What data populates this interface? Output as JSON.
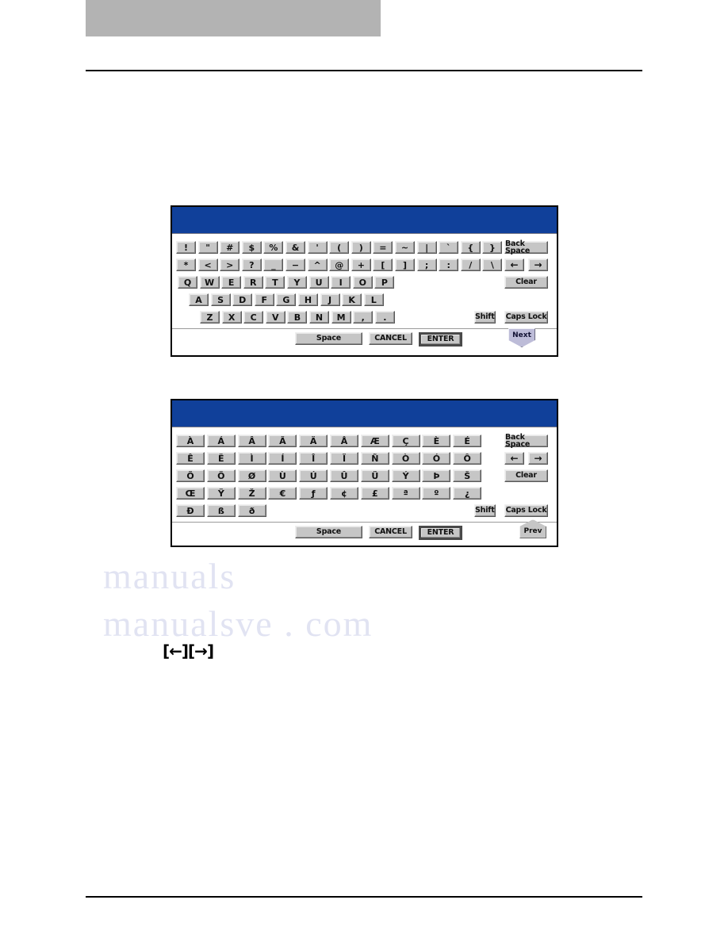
{
  "page": {
    "header_block_label": "",
    "arrow_legend": "[←][→]"
  },
  "keyboard_standard": {
    "title": "",
    "rows": [
      [
        "!",
        "\"",
        "#",
        "$",
        "%",
        "&",
        "'",
        "(",
        ")",
        "=",
        "~",
        "|",
        "`",
        "{",
        "}"
      ],
      [
        "*",
        "<",
        ">",
        "?",
        "_",
        "−",
        "^",
        "@",
        "+",
        "[",
        "]",
        ";",
        ":",
        "/",
        "\\"
      ],
      [
        "Q",
        "W",
        "E",
        "R",
        "T",
        "Y",
        "U",
        "I",
        "O",
        "P"
      ],
      [
        "A",
        "S",
        "D",
        "F",
        "G",
        "H",
        "J",
        "K",
        "L"
      ],
      [
        "Z",
        "X",
        "C",
        "V",
        "B",
        "N",
        "M",
        ",",
        "."
      ]
    ],
    "function_keys": {
      "back_space": "Back Space",
      "arrow_left": "←",
      "arrow_right": "→",
      "clear": "Clear",
      "shift": "Shift",
      "caps_lock": "Caps Lock",
      "page_tab": "Next"
    },
    "bottom_bar": {
      "space": "Space",
      "cancel": "CANCEL",
      "enter": "ENTER"
    }
  },
  "keyboard_accented": {
    "title": "",
    "rows": [
      [
        "À",
        "Á",
        "Â",
        "Ã",
        "Ä",
        "Å",
        "Æ",
        "Ç",
        "È",
        "É"
      ],
      [
        "Ê",
        "Ë",
        "Ì",
        "Í",
        "Î",
        "Ï",
        "Ñ",
        "Ò",
        "Ó",
        "Ô"
      ],
      [
        "Õ",
        "Ö",
        "Ø",
        "Ù",
        "Ú",
        "Û",
        "Ü",
        "Ý",
        "Þ",
        "Š"
      ],
      [
        "Œ",
        "Ÿ",
        "Ž",
        "€",
        "ƒ",
        "¢",
        "£",
        "ª",
        "º",
        "¿"
      ],
      [
        "Ð",
        "ß",
        "ð"
      ]
    ],
    "function_keys": {
      "back_space": "Back Space",
      "arrow_left": "←",
      "arrow_right": "→",
      "clear": "Clear",
      "shift": "Shift",
      "caps_lock": "Caps Lock",
      "page_tab": "Prev"
    },
    "bottom_bar": {
      "space": "Space",
      "cancel": "CANCEL",
      "enter": "ENTER"
    }
  },
  "watermark": {
    "line1": "c",
    "line2": "o",
    "line3": "m",
    "line4": "manualsve . com",
    "line5": "manuals"
  },
  "colors": {
    "titlebar_blue": "#10409a",
    "key_face": "#c6c6c6",
    "header_gray": "#b3b3b3",
    "tab_next": "#bdbcd8"
  }
}
